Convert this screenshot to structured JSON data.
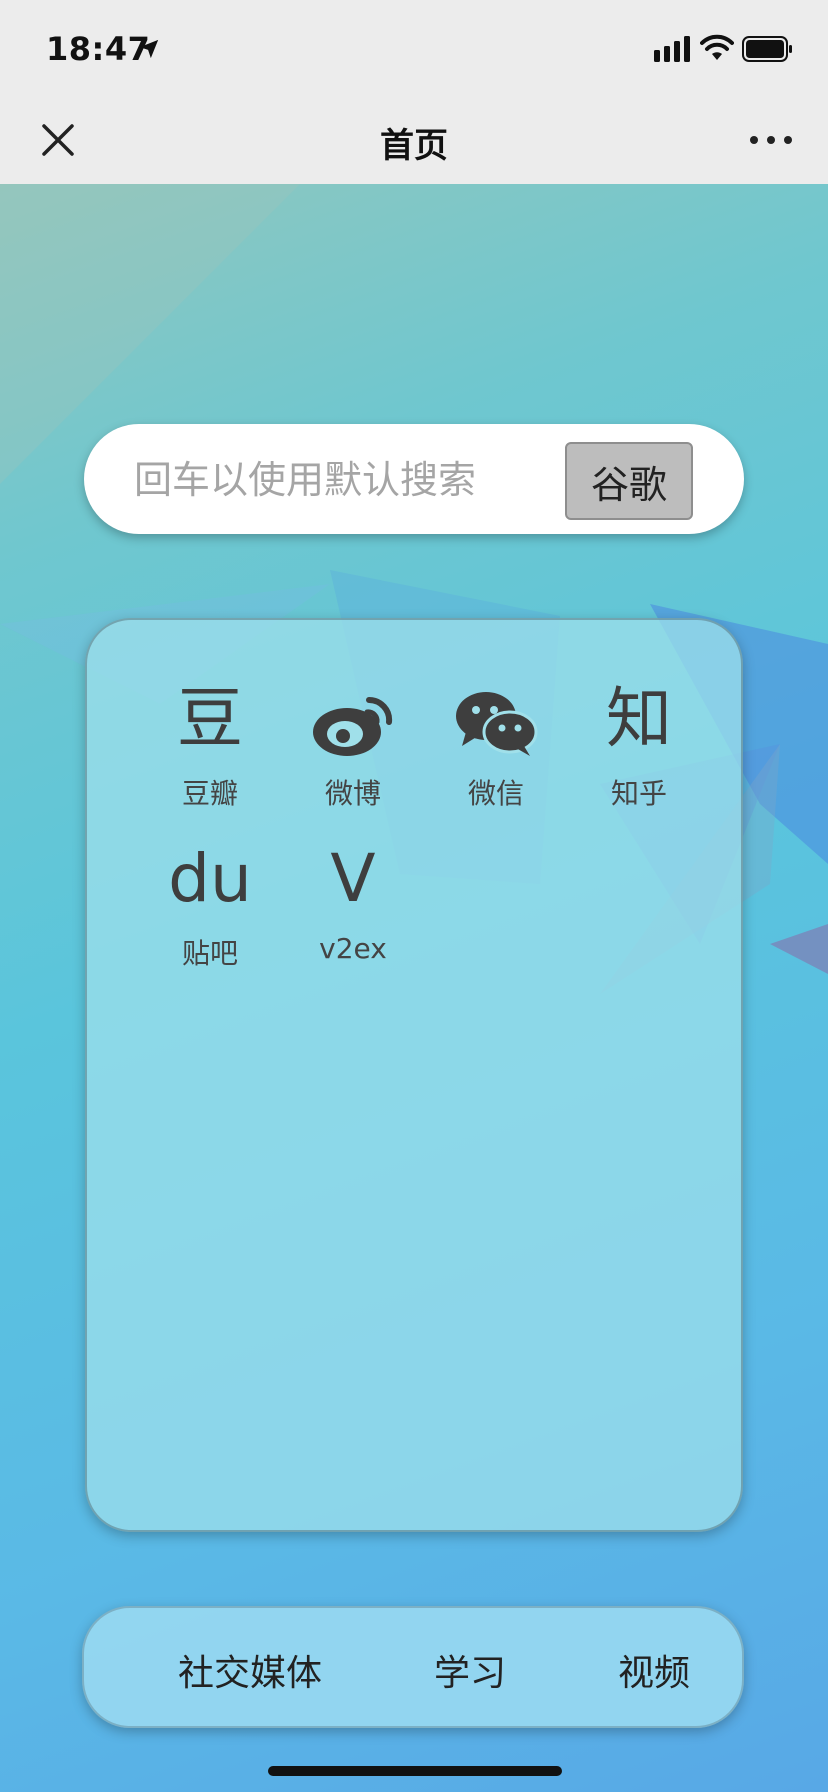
{
  "status_bar": {
    "time": "18:47",
    "icons": [
      "location-arrow-icon",
      "signal-icon",
      "wifi-icon",
      "battery-icon"
    ]
  },
  "nav": {
    "title": "首页",
    "close_icon": "close-icon",
    "more_icon": "more-icon"
  },
  "search": {
    "placeholder": "回车以使用默认搜索",
    "value": "",
    "button_label": "谷歌"
  },
  "links": [
    {
      "glyph": "豆",
      "label": "豆瓣",
      "icon": "douban-icon"
    },
    {
      "glyph": "",
      "label": "微博",
      "icon": "weibo-icon"
    },
    {
      "glyph": "",
      "label": "微信",
      "icon": "wechat-icon"
    },
    {
      "glyph": "知",
      "label": "知乎",
      "icon": "zhihu-icon"
    },
    {
      "glyph": "du",
      "label": "贴吧",
      "icon": "tieba-icon"
    },
    {
      "glyph": "V",
      "label": "v2ex",
      "icon": "v2ex-icon"
    }
  ],
  "tabs": [
    {
      "label": "社交媒体"
    },
    {
      "label": "学习"
    },
    {
      "label": "视频"
    }
  ],
  "colors": {
    "status_nav_bg": "#ececec",
    "background_gradient_start": "#8fc7bf",
    "background_gradient_end": "#58a8e6",
    "search_button_bg": "#bdbdbd",
    "icon_color": "#3e3e3e"
  }
}
